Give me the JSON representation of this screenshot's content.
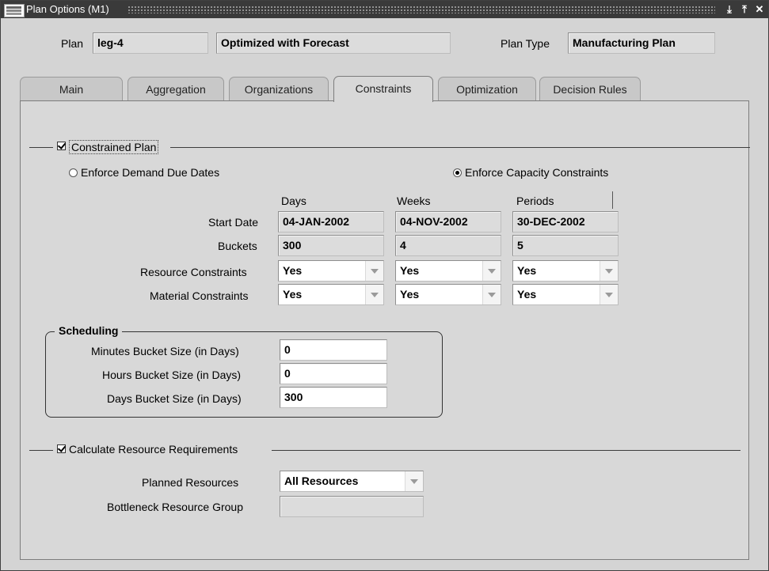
{
  "window": {
    "title": "Plan Options (M1)",
    "buttons": {
      "minimize": "⤓",
      "maximize": "⤒",
      "close": "✕"
    }
  },
  "header": {
    "plan_label": "Plan",
    "plan_value": "leg-4",
    "plan_desc": "Optimized with Forecast",
    "plan_type_label": "Plan Type",
    "plan_type_value": "Manufacturing Plan"
  },
  "tabs": [
    {
      "label": "Main"
    },
    {
      "label": "Aggregation"
    },
    {
      "label": "Organizations"
    },
    {
      "label": "Constraints",
      "active": true
    },
    {
      "label": "Optimization"
    },
    {
      "label": "Decision Rules"
    }
  ],
  "constraints": {
    "constrained_plan": {
      "label": "Constrained Plan",
      "checked": true
    },
    "enforce_demand": {
      "label": "Enforce Demand Due Dates",
      "selected": false
    },
    "enforce_capacity": {
      "label": "Enforce Capacity Constraints",
      "selected": true
    },
    "columns": {
      "days": "Days",
      "weeks": "Weeks",
      "periods": "Periods"
    },
    "start_date": {
      "label": "Start Date",
      "days": "04-JAN-2002",
      "weeks": "04-NOV-2002",
      "periods": "30-DEC-2002"
    },
    "buckets": {
      "label": "Buckets",
      "days": "300",
      "weeks": "4",
      "periods": "5"
    },
    "resource_constraints": {
      "label": "Resource Constraints",
      "days": "Yes",
      "weeks": "Yes",
      "periods": "Yes"
    },
    "material_constraints": {
      "label": "Material Constraints",
      "days": "Yes",
      "weeks": "Yes",
      "periods": "Yes"
    }
  },
  "scheduling": {
    "title": "Scheduling",
    "minutes": {
      "label": "Minutes Bucket Size (in Days)",
      "value": "0"
    },
    "hours": {
      "label": "Hours Bucket Size (in Days)",
      "value": "0"
    },
    "days": {
      "label": "Days Bucket Size (in Days)",
      "value": "300"
    }
  },
  "resources": {
    "calculate": {
      "label": "Calculate Resource Requirements",
      "checked": true
    },
    "planned_label": "Planned Resources",
    "planned_value": "All Resources",
    "bottleneck_label": "Bottleneck Resource Group",
    "bottleneck_value": ""
  }
}
